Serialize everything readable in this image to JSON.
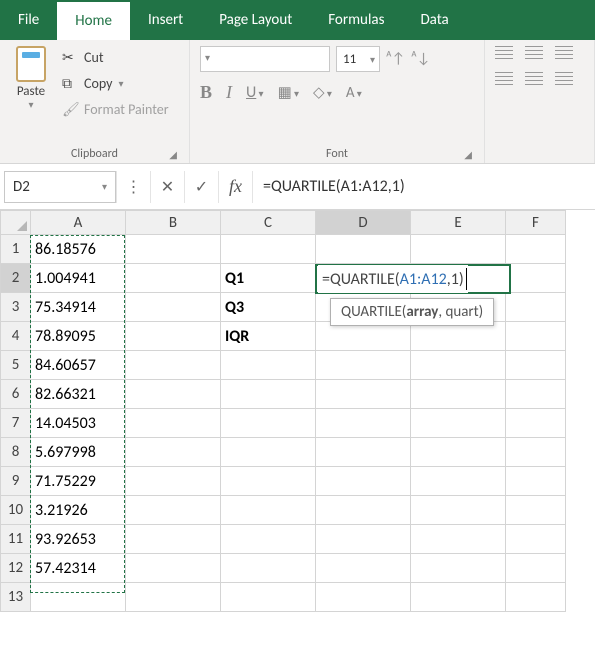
{
  "tabs": {
    "file": "File",
    "home": "Home",
    "insert": "Insert",
    "page_layout": "Page Layout",
    "formulas": "Formulas",
    "data": "Data"
  },
  "ribbon": {
    "clipboard": {
      "paste": "Paste",
      "cut": "Cut",
      "copy": "Copy",
      "format_painter": "Format Painter",
      "label": "Clipboard"
    },
    "font": {
      "size": "11",
      "bold": "B",
      "italic": "I",
      "underline": "U",
      "label": "Font"
    }
  },
  "fxbar": {
    "namebox": "D2",
    "cancel": "✕",
    "enter": "✓",
    "fx": "fx",
    "formula": "=QUARTILE(A1:A12,1)"
  },
  "columns": [
    "A",
    "B",
    "C",
    "D",
    "E",
    "F"
  ],
  "rows": {
    "1": {
      "A": "86.18576"
    },
    "2": {
      "A": "1.004941",
      "C": "Q1"
    },
    "3": {
      "A": "75.34914",
      "C": "Q3"
    },
    "4": {
      "A": "78.89095",
      "C": "IQR"
    },
    "5": {
      "A": "84.60657"
    },
    "6": {
      "A": "82.66321"
    },
    "7": {
      "A": "14.04503"
    },
    "8": {
      "A": "5.697998"
    },
    "9": {
      "A": "71.75229"
    },
    "10": {
      "A": "3.21926"
    },
    "11": {
      "A": "93.92653"
    },
    "12": {
      "A": "57.42314"
    },
    "13": {}
  },
  "editing": {
    "pre": "=QUARTILE(",
    "ref": "A1:A12",
    "post": ",1)"
  },
  "tooltip": {
    "fn": "QUARTILE(",
    "arg1": "array",
    "rest": ", quart)"
  }
}
